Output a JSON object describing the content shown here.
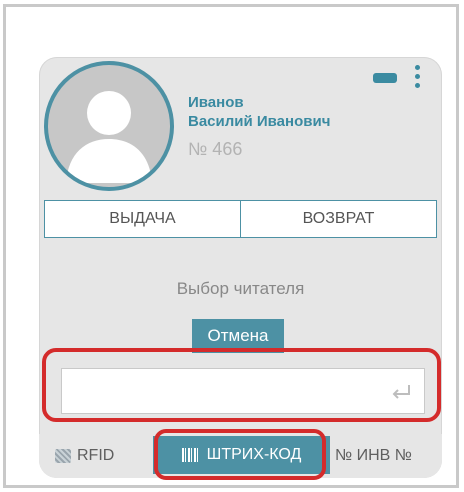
{
  "reader": {
    "last_name": "Иванов",
    "first_patronymic": "Василий Иванович",
    "card_number": "№ 466"
  },
  "modes": {
    "issue_label": "ВЫДАЧА",
    "return_label": "ВОЗВРАТ"
  },
  "prompt": "Выбор читателя",
  "cancel_label": "Отмена",
  "input": {
    "value": "",
    "placeholder": ""
  },
  "tabs": {
    "rfid_label": "RFID",
    "barcode_label": "ШТРИХ-КОД",
    "inventory_label": "№ ИНВ №"
  },
  "colors": {
    "accent": "#4d91a4",
    "highlight": "#d42b2b"
  }
}
